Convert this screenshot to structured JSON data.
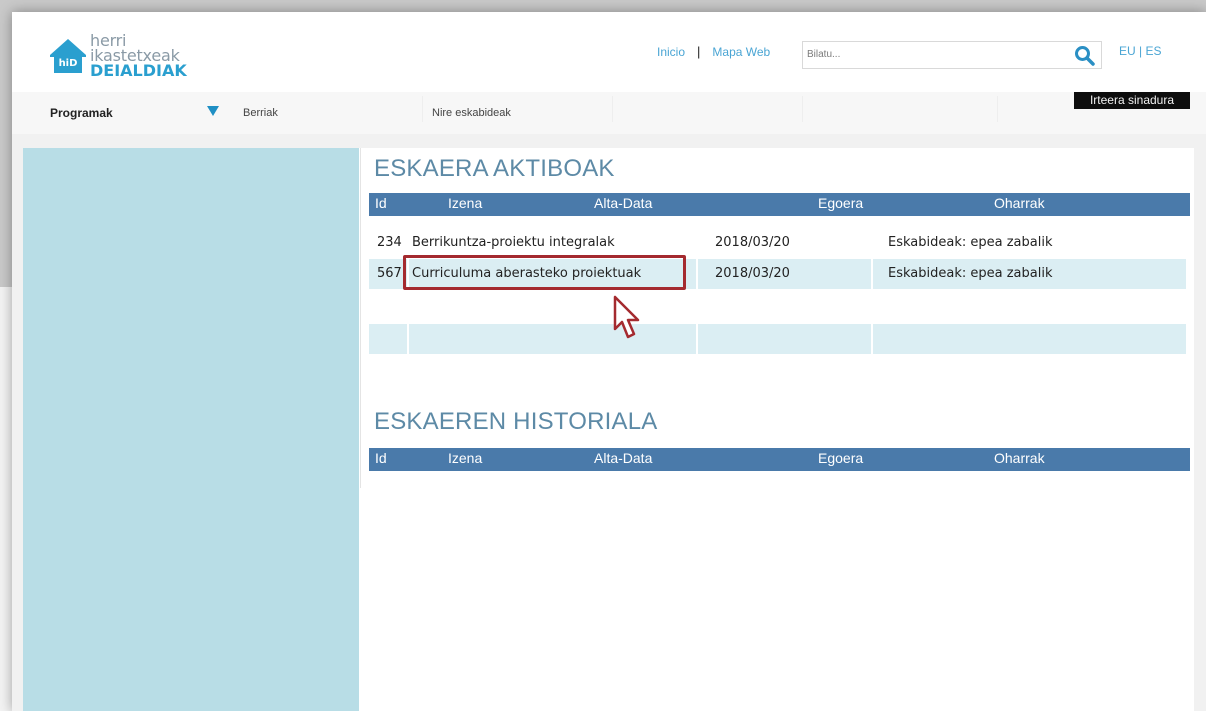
{
  "header": {
    "logo": {
      "line1": "herri",
      "line2": "ikastetxeak",
      "line3": "DEIALDIAK",
      "badge": "hiD"
    },
    "links": {
      "inicio": "Inicio",
      "mapa_web": "Mapa Web",
      "separator": "|"
    },
    "search": {
      "placeholder": "Bilatu..."
    },
    "lang": "EU | ES"
  },
  "nav": {
    "programak": "Programak",
    "berriak": "Berriak",
    "nire_eskabideak": "Nire eskabideak",
    "logout": "Irteera sinadura"
  },
  "active_requests": {
    "title": "ESKAERA AKTIBOAK",
    "columns": {
      "id": "Id",
      "izena": "Izena",
      "alta_data": "Alta-Data",
      "egoera": "Egoera",
      "oharrak": "Oharrak"
    },
    "rows": [
      {
        "id": "234",
        "izena": "Berrikuntza-proiektu integralak",
        "alta_data": "2018/03/20",
        "egoera": "Eskabideak: epea zabalik"
      },
      {
        "id": "567",
        "izena": "Curriculuma aberasteko proiektuak",
        "alta_data": "2018/03/20",
        "egoera": "Eskabideak: epea zabalik"
      }
    ]
  },
  "history": {
    "title": "ESKAEREN HISTORIALA",
    "columns": {
      "id": "Id",
      "izena": "Izena",
      "alta_data": "Alta-Data",
      "egoera": "Egoera",
      "oharrak": "Oharrak"
    }
  },
  "colors": {
    "accent_blue": "#4a7aaa",
    "title_blue": "#5d8aa6",
    "sidebar": "#b8dde6",
    "row_alt": "#dbeef3",
    "highlight": "#a42a2f",
    "link": "#4aa5d4"
  }
}
